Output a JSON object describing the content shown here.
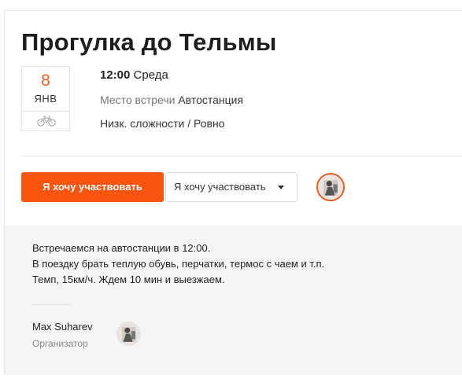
{
  "event": {
    "title": "Прогулка до Тельмы",
    "date": {
      "day": "8",
      "month": "ЯНВ"
    },
    "time": "12:00",
    "weekday": "Среда",
    "place_label": "Место встречи",
    "place": "Автостанция",
    "level": "Низк. сложности / Ровно"
  },
  "actions": {
    "join_label": "Я хочу участвовать",
    "dropdown_label": "Я хочу участвовать"
  },
  "description": {
    "lines": [
      "Встречаемся на автостанции в 12:00.",
      "В поездку брать теплую обувь, перчатки, термос с чаем и т.п.",
      "Темп, 15км/ч. Ждем 10 мин и выезжаем."
    ]
  },
  "organizer": {
    "name": "Max Suharev",
    "role": "Организатор"
  },
  "colors": {
    "accent": "#f6540f",
    "panel": "#f5f5f5"
  },
  "icons": {
    "activity": "bicycle-icon",
    "dropdown": "caret-down-icon"
  }
}
